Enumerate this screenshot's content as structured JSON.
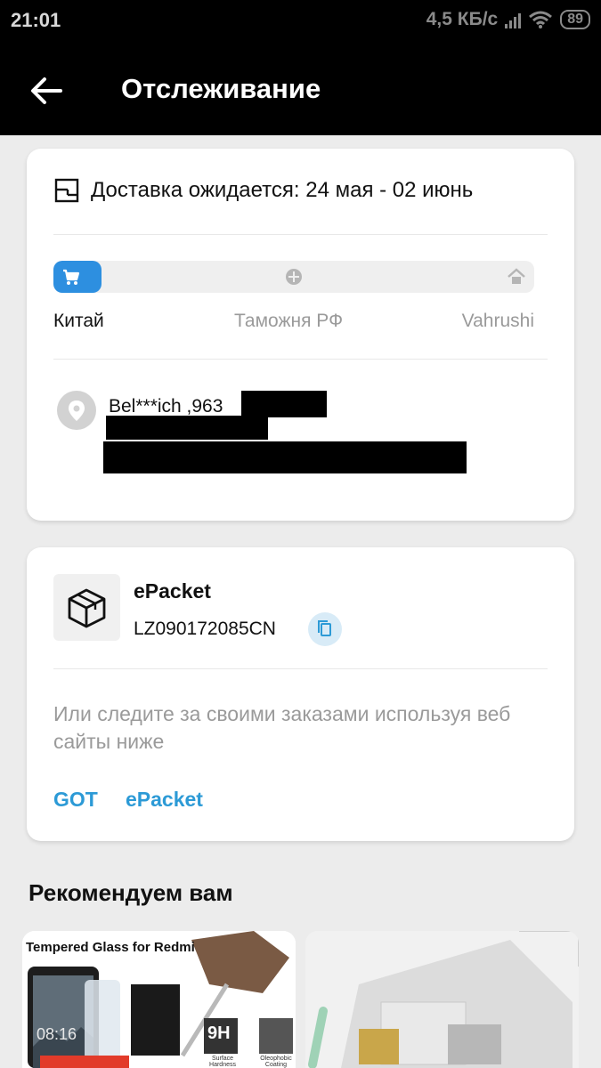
{
  "status_bar": {
    "time": "21:01",
    "network_speed": "4,5 КБ/с",
    "battery": "89"
  },
  "header": {
    "back_icon": "arrow-left-icon",
    "title": "Отслеживание"
  },
  "delivery": {
    "icon": "calendar-box-icon",
    "text": "Доставка ожидается: 24 мая - 02 июнь",
    "progress_fraction": 0.1,
    "stages": [
      {
        "label": "Китай",
        "icon": "cart-icon",
        "active": true
      },
      {
        "label": "Таможня РФ",
        "icon": "customs-icon",
        "active": false
      },
      {
        "label": "Vahrushi",
        "icon": "home-icon",
        "active": false
      }
    ],
    "active_color": "#2d8fe0"
  },
  "address": {
    "icon": "location-pin-icon",
    "name_line": "Bel***ich ,963"
  },
  "package": {
    "icon": "package-box-icon",
    "carrier": "ePacket",
    "tracking_number": "LZ090172085CN",
    "copy_icon": "copy-icon",
    "hint": "Или следите за своими заказами используя веб сайты ниже",
    "links": [
      "GOT",
      "ePacket"
    ],
    "link_color": "#2c9ad6"
  },
  "recommendations": {
    "title": "Рекомендуем вам",
    "products": [
      {
        "banner_text": "Tempered Glass for Redmi",
        "clock": "08:16",
        "badge_1": "9H",
        "badge_2": "Surface Hardness",
        "badge_3": "Oleophobic Coating"
      },
      {
        "image": "card-holder-photo"
      }
    ]
  }
}
